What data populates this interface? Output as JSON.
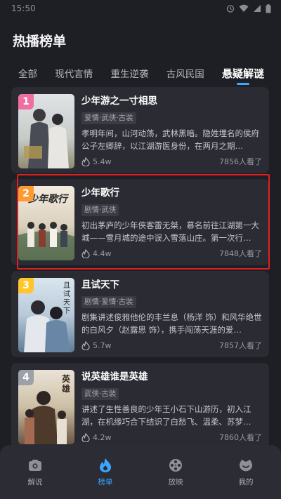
{
  "status_bar": {
    "time": "15:50"
  },
  "header": {
    "title": "热播榜单"
  },
  "tabs": [
    {
      "label": "全部",
      "active": false
    },
    {
      "label": "现代言情",
      "active": false
    },
    {
      "label": "重生逆袭",
      "active": false
    },
    {
      "label": "古风民国",
      "active": false
    },
    {
      "label": "悬疑解谜",
      "active": true
    }
  ],
  "list": [
    {
      "rank": "1",
      "rank_color": "#f06ea1",
      "title": "少年游之一寸相思",
      "tag": "爱情·武侠·古装",
      "desc": "孝明年间，山河动荡，武林黑暗。隐姓埋名的侯府公子左卿辞，以江湖游医身份，在两月之期…",
      "heat": "5.4w",
      "viewers": "7856人看了"
    },
    {
      "rank": "2",
      "rank_color": "#ff9a32",
      "title": "少年歌行",
      "tag": "剧情·武侠",
      "desc": "初出茅庐的少年侠客雷无桀，慕名前往江湖第一大城——雪月城的途中误入雪落山庄。第一次行…",
      "heat": "4.4w",
      "viewers": "7848人看了",
      "poster_text": "少年歌行"
    },
    {
      "rank": "3",
      "rank_color": "#ffc52a",
      "title": "且试天下",
      "tag": "剧情·爱情·古装",
      "desc": "剧集讲述俊雅他伦的丰兰息（杨洋 饰）和风华绝世的白风夕（赵露思 饰），携手闯荡天涯的爱…",
      "heat": "5.7w",
      "viewers": "7857人看了",
      "poster_text": "且试天下"
    },
    {
      "rank": "4",
      "rank_color": "#9ea0a8",
      "title": "说英雄谁是英雄",
      "tag": "武侠·古装",
      "desc": "讲述了生性善良的少年王小石下山游历，初入江湖，在机缘巧合下结识了白愁飞、温柔、苏梦…",
      "heat": "4.2w",
      "viewers": "7860人看了",
      "poster_text": "英雄"
    }
  ],
  "bottom_nav": [
    {
      "label": "解说",
      "icon": "camera-icon",
      "active": false
    },
    {
      "label": "榜单",
      "icon": "flame-icon",
      "active": true
    },
    {
      "label": "放映",
      "icon": "film-reel-icon",
      "active": false
    },
    {
      "label": "我的",
      "icon": "smile-icon",
      "active": false
    }
  ],
  "colors": {
    "accent": "#3aa6ff",
    "background": "#1e1f24",
    "card": "#2b2c33",
    "highlight_border": "#e02020"
  }
}
